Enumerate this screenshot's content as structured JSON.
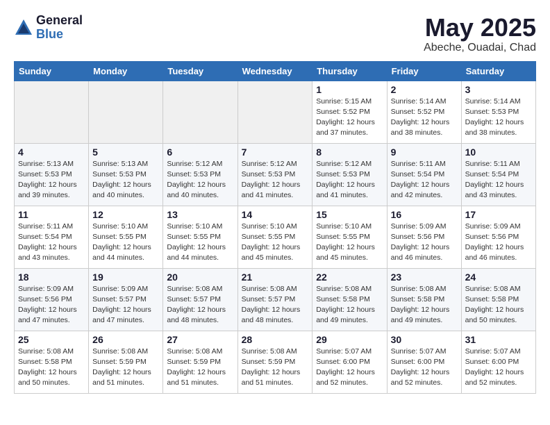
{
  "logo": {
    "general": "General",
    "blue": "Blue"
  },
  "header": {
    "title": "May 2025",
    "location": "Abeche, Ouadai, Chad"
  },
  "days_of_week": [
    "Sunday",
    "Monday",
    "Tuesday",
    "Wednesday",
    "Thursday",
    "Friday",
    "Saturday"
  ],
  "weeks": [
    [
      {
        "day": "",
        "info": ""
      },
      {
        "day": "",
        "info": ""
      },
      {
        "day": "",
        "info": ""
      },
      {
        "day": "",
        "info": ""
      },
      {
        "day": "1",
        "info": "Sunrise: 5:15 AM\nSunset: 5:52 PM\nDaylight: 12 hours\nand 37 minutes."
      },
      {
        "day": "2",
        "info": "Sunrise: 5:14 AM\nSunset: 5:52 PM\nDaylight: 12 hours\nand 38 minutes."
      },
      {
        "day": "3",
        "info": "Sunrise: 5:14 AM\nSunset: 5:53 PM\nDaylight: 12 hours\nand 38 minutes."
      }
    ],
    [
      {
        "day": "4",
        "info": "Sunrise: 5:13 AM\nSunset: 5:53 PM\nDaylight: 12 hours\nand 39 minutes."
      },
      {
        "day": "5",
        "info": "Sunrise: 5:13 AM\nSunset: 5:53 PM\nDaylight: 12 hours\nand 40 minutes."
      },
      {
        "day": "6",
        "info": "Sunrise: 5:12 AM\nSunset: 5:53 PM\nDaylight: 12 hours\nand 40 minutes."
      },
      {
        "day": "7",
        "info": "Sunrise: 5:12 AM\nSunset: 5:53 PM\nDaylight: 12 hours\nand 41 minutes."
      },
      {
        "day": "8",
        "info": "Sunrise: 5:12 AM\nSunset: 5:53 PM\nDaylight: 12 hours\nand 41 minutes."
      },
      {
        "day": "9",
        "info": "Sunrise: 5:11 AM\nSunset: 5:54 PM\nDaylight: 12 hours\nand 42 minutes."
      },
      {
        "day": "10",
        "info": "Sunrise: 5:11 AM\nSunset: 5:54 PM\nDaylight: 12 hours\nand 43 minutes."
      }
    ],
    [
      {
        "day": "11",
        "info": "Sunrise: 5:11 AM\nSunset: 5:54 PM\nDaylight: 12 hours\nand 43 minutes."
      },
      {
        "day": "12",
        "info": "Sunrise: 5:10 AM\nSunset: 5:55 PM\nDaylight: 12 hours\nand 44 minutes."
      },
      {
        "day": "13",
        "info": "Sunrise: 5:10 AM\nSunset: 5:55 PM\nDaylight: 12 hours\nand 44 minutes."
      },
      {
        "day": "14",
        "info": "Sunrise: 5:10 AM\nSunset: 5:55 PM\nDaylight: 12 hours\nand 45 minutes."
      },
      {
        "day": "15",
        "info": "Sunrise: 5:10 AM\nSunset: 5:55 PM\nDaylight: 12 hours\nand 45 minutes."
      },
      {
        "day": "16",
        "info": "Sunrise: 5:09 AM\nSunset: 5:56 PM\nDaylight: 12 hours\nand 46 minutes."
      },
      {
        "day": "17",
        "info": "Sunrise: 5:09 AM\nSunset: 5:56 PM\nDaylight: 12 hours\nand 46 minutes."
      }
    ],
    [
      {
        "day": "18",
        "info": "Sunrise: 5:09 AM\nSunset: 5:56 PM\nDaylight: 12 hours\nand 47 minutes."
      },
      {
        "day": "19",
        "info": "Sunrise: 5:09 AM\nSunset: 5:57 PM\nDaylight: 12 hours\nand 47 minutes."
      },
      {
        "day": "20",
        "info": "Sunrise: 5:08 AM\nSunset: 5:57 PM\nDaylight: 12 hours\nand 48 minutes."
      },
      {
        "day": "21",
        "info": "Sunrise: 5:08 AM\nSunset: 5:57 PM\nDaylight: 12 hours\nand 48 minutes."
      },
      {
        "day": "22",
        "info": "Sunrise: 5:08 AM\nSunset: 5:58 PM\nDaylight: 12 hours\nand 49 minutes."
      },
      {
        "day": "23",
        "info": "Sunrise: 5:08 AM\nSunset: 5:58 PM\nDaylight: 12 hours\nand 49 minutes."
      },
      {
        "day": "24",
        "info": "Sunrise: 5:08 AM\nSunset: 5:58 PM\nDaylight: 12 hours\nand 50 minutes."
      }
    ],
    [
      {
        "day": "25",
        "info": "Sunrise: 5:08 AM\nSunset: 5:58 PM\nDaylight: 12 hours\nand 50 minutes."
      },
      {
        "day": "26",
        "info": "Sunrise: 5:08 AM\nSunset: 5:59 PM\nDaylight: 12 hours\nand 51 minutes."
      },
      {
        "day": "27",
        "info": "Sunrise: 5:08 AM\nSunset: 5:59 PM\nDaylight: 12 hours\nand 51 minutes."
      },
      {
        "day": "28",
        "info": "Sunrise: 5:08 AM\nSunset: 5:59 PM\nDaylight: 12 hours\nand 51 minutes."
      },
      {
        "day": "29",
        "info": "Sunrise: 5:07 AM\nSunset: 6:00 PM\nDaylight: 12 hours\nand 52 minutes."
      },
      {
        "day": "30",
        "info": "Sunrise: 5:07 AM\nSunset: 6:00 PM\nDaylight: 12 hours\nand 52 minutes."
      },
      {
        "day": "31",
        "info": "Sunrise: 5:07 AM\nSunset: 6:00 PM\nDaylight: 12 hours\nand 52 minutes."
      }
    ]
  ]
}
